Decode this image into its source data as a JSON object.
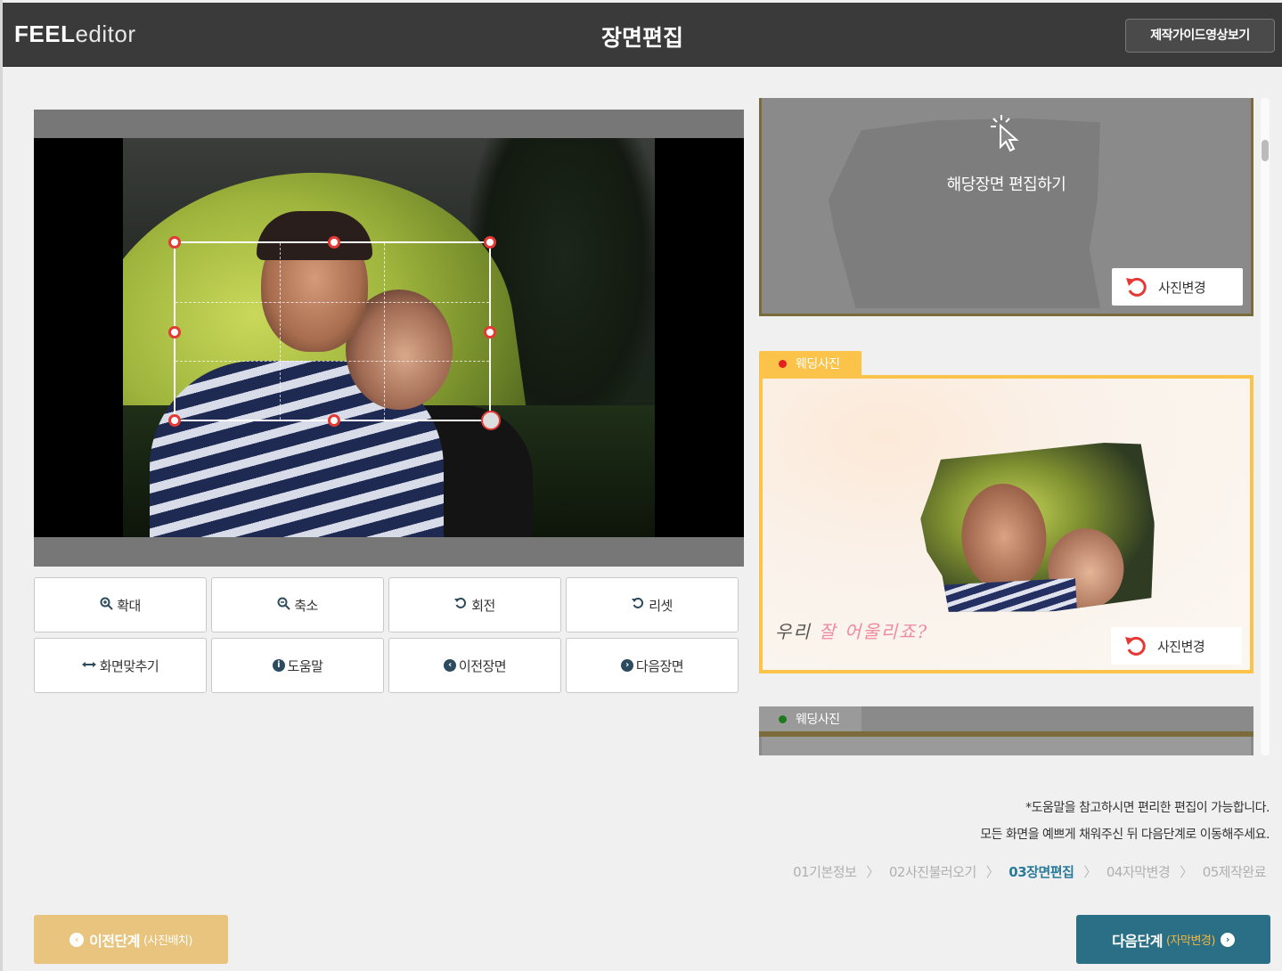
{
  "header": {
    "logo_bold": "FEEL",
    "logo_light": "editor",
    "title": "장면편집",
    "guide_button": "제작가이드영상보기"
  },
  "toolbar": {
    "zoom_in": "확대",
    "zoom_out": "축소",
    "rotate": "회전",
    "reset": "리셋",
    "fit_screen": "화면맞추기",
    "help": "도움말",
    "prev_scene": "이전장면",
    "next_scene": "다음장면"
  },
  "scenes": {
    "scene1": {
      "edit_text": "해당장면 편집하기",
      "change_photo": "사진변경"
    },
    "scene2": {
      "tag": "웨딩사진",
      "caption_plain": "우리 ",
      "caption_pink": "잘 어울리죠?",
      "change_photo": "사진변경"
    },
    "scene3": {
      "tag": "웨딩사진"
    }
  },
  "notes": {
    "line1": "*도움말을 참고하시면 편리한 편집이 가능합니다.",
    "line2": "모든 화면을 예쁘게 채워주신 뒤 다음단계로 이동해주세요."
  },
  "steps": [
    {
      "num": "01",
      "label": "기본정보"
    },
    {
      "num": "02",
      "label": "사진불러오기"
    },
    {
      "num": "03",
      "label": "장면편집"
    },
    {
      "num": "04",
      "label": "자막변경"
    },
    {
      "num": "05",
      "label": "제작완료"
    }
  ],
  "footer": {
    "prev_label": "이전단계",
    "prev_sub": "(사진배치)",
    "next_label": "다음단계",
    "next_sub": "(자막변경)"
  },
  "colors": {
    "header_bg": "#3a3a3a",
    "accent_yellow": "#fbc34a",
    "next_button": "#2a6f86",
    "prev_button": "#e8c47e",
    "active_step": "#2a7a9a",
    "handle_red": "#e53935"
  }
}
